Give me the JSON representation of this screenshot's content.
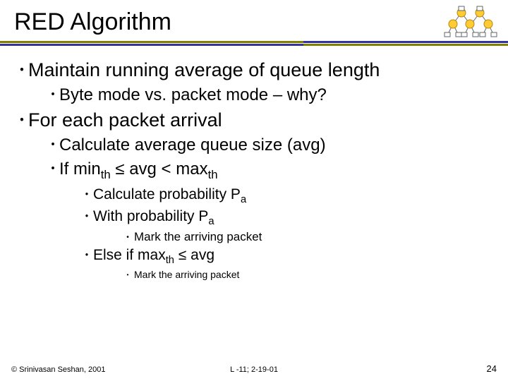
{
  "title": "RED Algorithm",
  "bullets": {
    "b1": "Maintain running average of queue length",
    "b1_1": "Byte mode vs. packet mode – why?",
    "b2": "For each packet arrival",
    "b2_1": "Calculate average queue size (avg)",
    "b2_2_pre": "If min",
    "b2_2_sub1": "th",
    "b2_2_mid": " ≤ avg < max",
    "b2_2_sub2": "th",
    "b2_2_1_pre": "Calculate probability P",
    "b2_2_1_sub": "a",
    "b2_2_2_pre": "With probability P",
    "b2_2_2_sub": "a",
    "b2_2_2_1": "Mark the arriving packet",
    "b2_3_pre": "Else if max",
    "b2_3_sub": "th",
    "b2_3_post": " ≤ avg",
    "b2_3_1": "Mark the arriving packet"
  },
  "footer": {
    "left": "© Srinivasan Seshan, 2001",
    "center": "L -11; 2-19-01",
    "right": "24"
  }
}
